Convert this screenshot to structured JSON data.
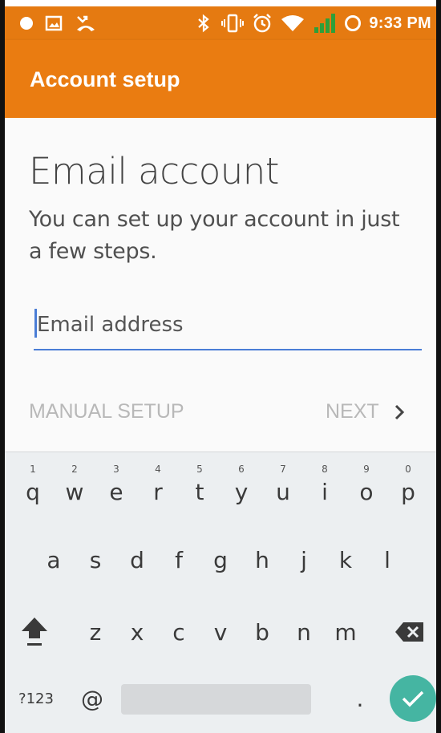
{
  "status_bar": {
    "time": "9:33 PM",
    "left_icons": [
      "record-icon",
      "image-icon",
      "missed-call-icon"
    ],
    "right_icons": [
      "bluetooth-icon",
      "vibrate-icon",
      "alarm-icon",
      "wifi-icon",
      "signal-icon",
      "sync-icon"
    ]
  },
  "app_bar": {
    "title": "Account setup"
  },
  "main": {
    "heading": "Email account",
    "subtitle": "You can set up your account in just a few steps.",
    "email_placeholder": "Email address",
    "manual_setup_label": "MANUAL SETUP",
    "next_label": "NEXT"
  },
  "keyboard": {
    "row1": [
      {
        "key": "q",
        "hint": "1"
      },
      {
        "key": "w",
        "hint": "2"
      },
      {
        "key": "e",
        "hint": "3"
      },
      {
        "key": "r",
        "hint": "4"
      },
      {
        "key": "t",
        "hint": "5"
      },
      {
        "key": "y",
        "hint": "6"
      },
      {
        "key": "u",
        "hint": "7"
      },
      {
        "key": "i",
        "hint": "8"
      },
      {
        "key": "o",
        "hint": "9"
      },
      {
        "key": "p",
        "hint": "0"
      }
    ],
    "row2": [
      "a",
      "s",
      "d",
      "f",
      "g",
      "h",
      "j",
      "k",
      "l"
    ],
    "row3": [
      "z",
      "x",
      "c",
      "v",
      "b",
      "n",
      "m"
    ],
    "symbols_label": "?123",
    "at_label": "@",
    "period_label": "."
  },
  "colors": {
    "accent": "#ea7c11",
    "focus": "#4a7dd6",
    "enter": "#45b5a2"
  }
}
